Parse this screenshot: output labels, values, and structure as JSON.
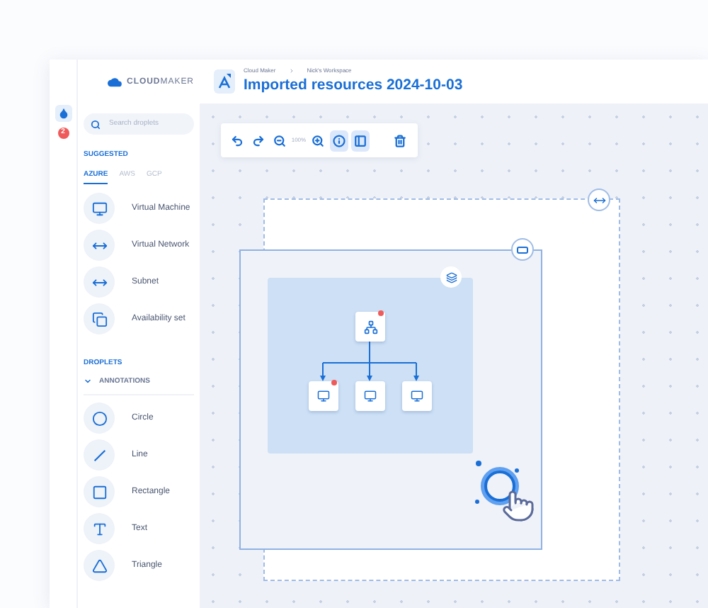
{
  "rail": {
    "badge": "2"
  },
  "logo": "**CLOUD**MAKER",
  "search": {
    "placeholder": "Search droplets"
  },
  "suggested": {
    "heading": "SUGGESTED",
    "tabs": [
      {
        "label": "AZURE",
        "selected": true
      },
      {
        "label": "AWS",
        "selected": false
      },
      {
        "label": "GCP",
        "selected": false
      }
    ],
    "items": [
      {
        "label": "Virtual Machine",
        "kind": "monitor"
      },
      {
        "label": "Virtual Network",
        "kind": "network"
      },
      {
        "label": "Subnet",
        "kind": "network"
      },
      {
        "label": "Availability set",
        "kind": "set"
      }
    ]
  },
  "droplets": {
    "heading": "DROPLETS",
    "group": {
      "label": "ANNOTATIONS",
      "expanded": true
    },
    "items": [
      {
        "label": "Circle",
        "kind": "circle"
      },
      {
        "label": "Line",
        "kind": "line"
      },
      {
        "label": "Rectangle",
        "kind": "rectangle"
      },
      {
        "label": "Text",
        "kind": "text"
      },
      {
        "label": "Triangle",
        "kind": "triangle"
      }
    ]
  },
  "breadcrumb": [
    "Cloud Maker",
    "Nick's Workspace"
  ],
  "title": "Imported resources 2024-10-03",
  "toolbar": {
    "zoom": "100%",
    "tools": [
      {
        "kind": "undo",
        "active": false
      },
      {
        "kind": "redo",
        "active": false
      },
      {
        "kind": "zoom-out",
        "active": false
      },
      {
        "kind": "zoom-in",
        "active": false
      },
      {
        "kind": "info",
        "active": true
      },
      {
        "kind": "frame",
        "active": true
      },
      {
        "kind": "delete",
        "active": false
      }
    ]
  },
  "diagram": {
    "root": {
      "alert": true
    },
    "children": [
      {
        "alert": true
      },
      {
        "alert": false
      },
      {
        "alert": false
      }
    ]
  }
}
